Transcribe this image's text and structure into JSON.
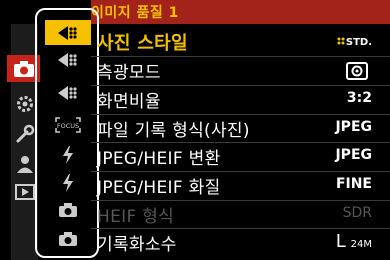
{
  "header": {
    "title": "이미지 품질 1"
  },
  "colors": {
    "accent_red": "#c7231a",
    "header_red": "#a3231a",
    "highlight_yellow": "#f4c000",
    "disabled_gray": "#555555"
  },
  "categories": [
    {
      "icon": "camera-icon",
      "active": true
    },
    {
      "icon": "gear-icon",
      "active": false
    },
    {
      "icon": "wrench-icon",
      "active": false
    },
    {
      "icon": "person-icon",
      "active": false
    },
    {
      "icon": "playback-icon",
      "active": false
    }
  ],
  "subtabs": [
    {
      "icon": "image-quality-1-icon",
      "active": true
    },
    {
      "icon": "image-quality-2-icon",
      "active": false
    },
    {
      "icon": "image-quality-3-icon",
      "active": false
    },
    {
      "icon": "focus-icon",
      "text": "FOCUS",
      "active": false
    },
    {
      "icon": "flash-icon",
      "active": false
    },
    {
      "icon": "flash-2-icon",
      "active": false
    },
    {
      "icon": "camera-others-1-icon",
      "active": false
    },
    {
      "icon": "camera-others-2-icon",
      "active": false
    }
  ],
  "menu": {
    "items": [
      {
        "label": "사진 스타일",
        "value": "STD.",
        "value_icon": "photo-style-standard-icon",
        "selected": true,
        "disabled": false
      },
      {
        "label": "측광모드",
        "value": "",
        "value_icon": "metering-multi-icon",
        "selected": false,
        "disabled": false
      },
      {
        "label": "화면비율",
        "value": "3:2",
        "selected": false,
        "disabled": false
      },
      {
        "label": "파일 기록 형식(사진)",
        "value": "JPEG",
        "selected": false,
        "disabled": false
      },
      {
        "label": "JPEG/HEIF 변환",
        "value": "JPEG",
        "selected": false,
        "disabled": false
      },
      {
        "label": "JPEG/HEIF 화질",
        "value": "FINE",
        "selected": false,
        "disabled": false
      },
      {
        "label": "HEIF 형식",
        "value": "SDR",
        "selected": false,
        "disabled": true
      },
      {
        "label": "기록화소수",
        "value_main": "L",
        "value_sub": "24M",
        "selected": false,
        "disabled": false
      }
    ]
  }
}
